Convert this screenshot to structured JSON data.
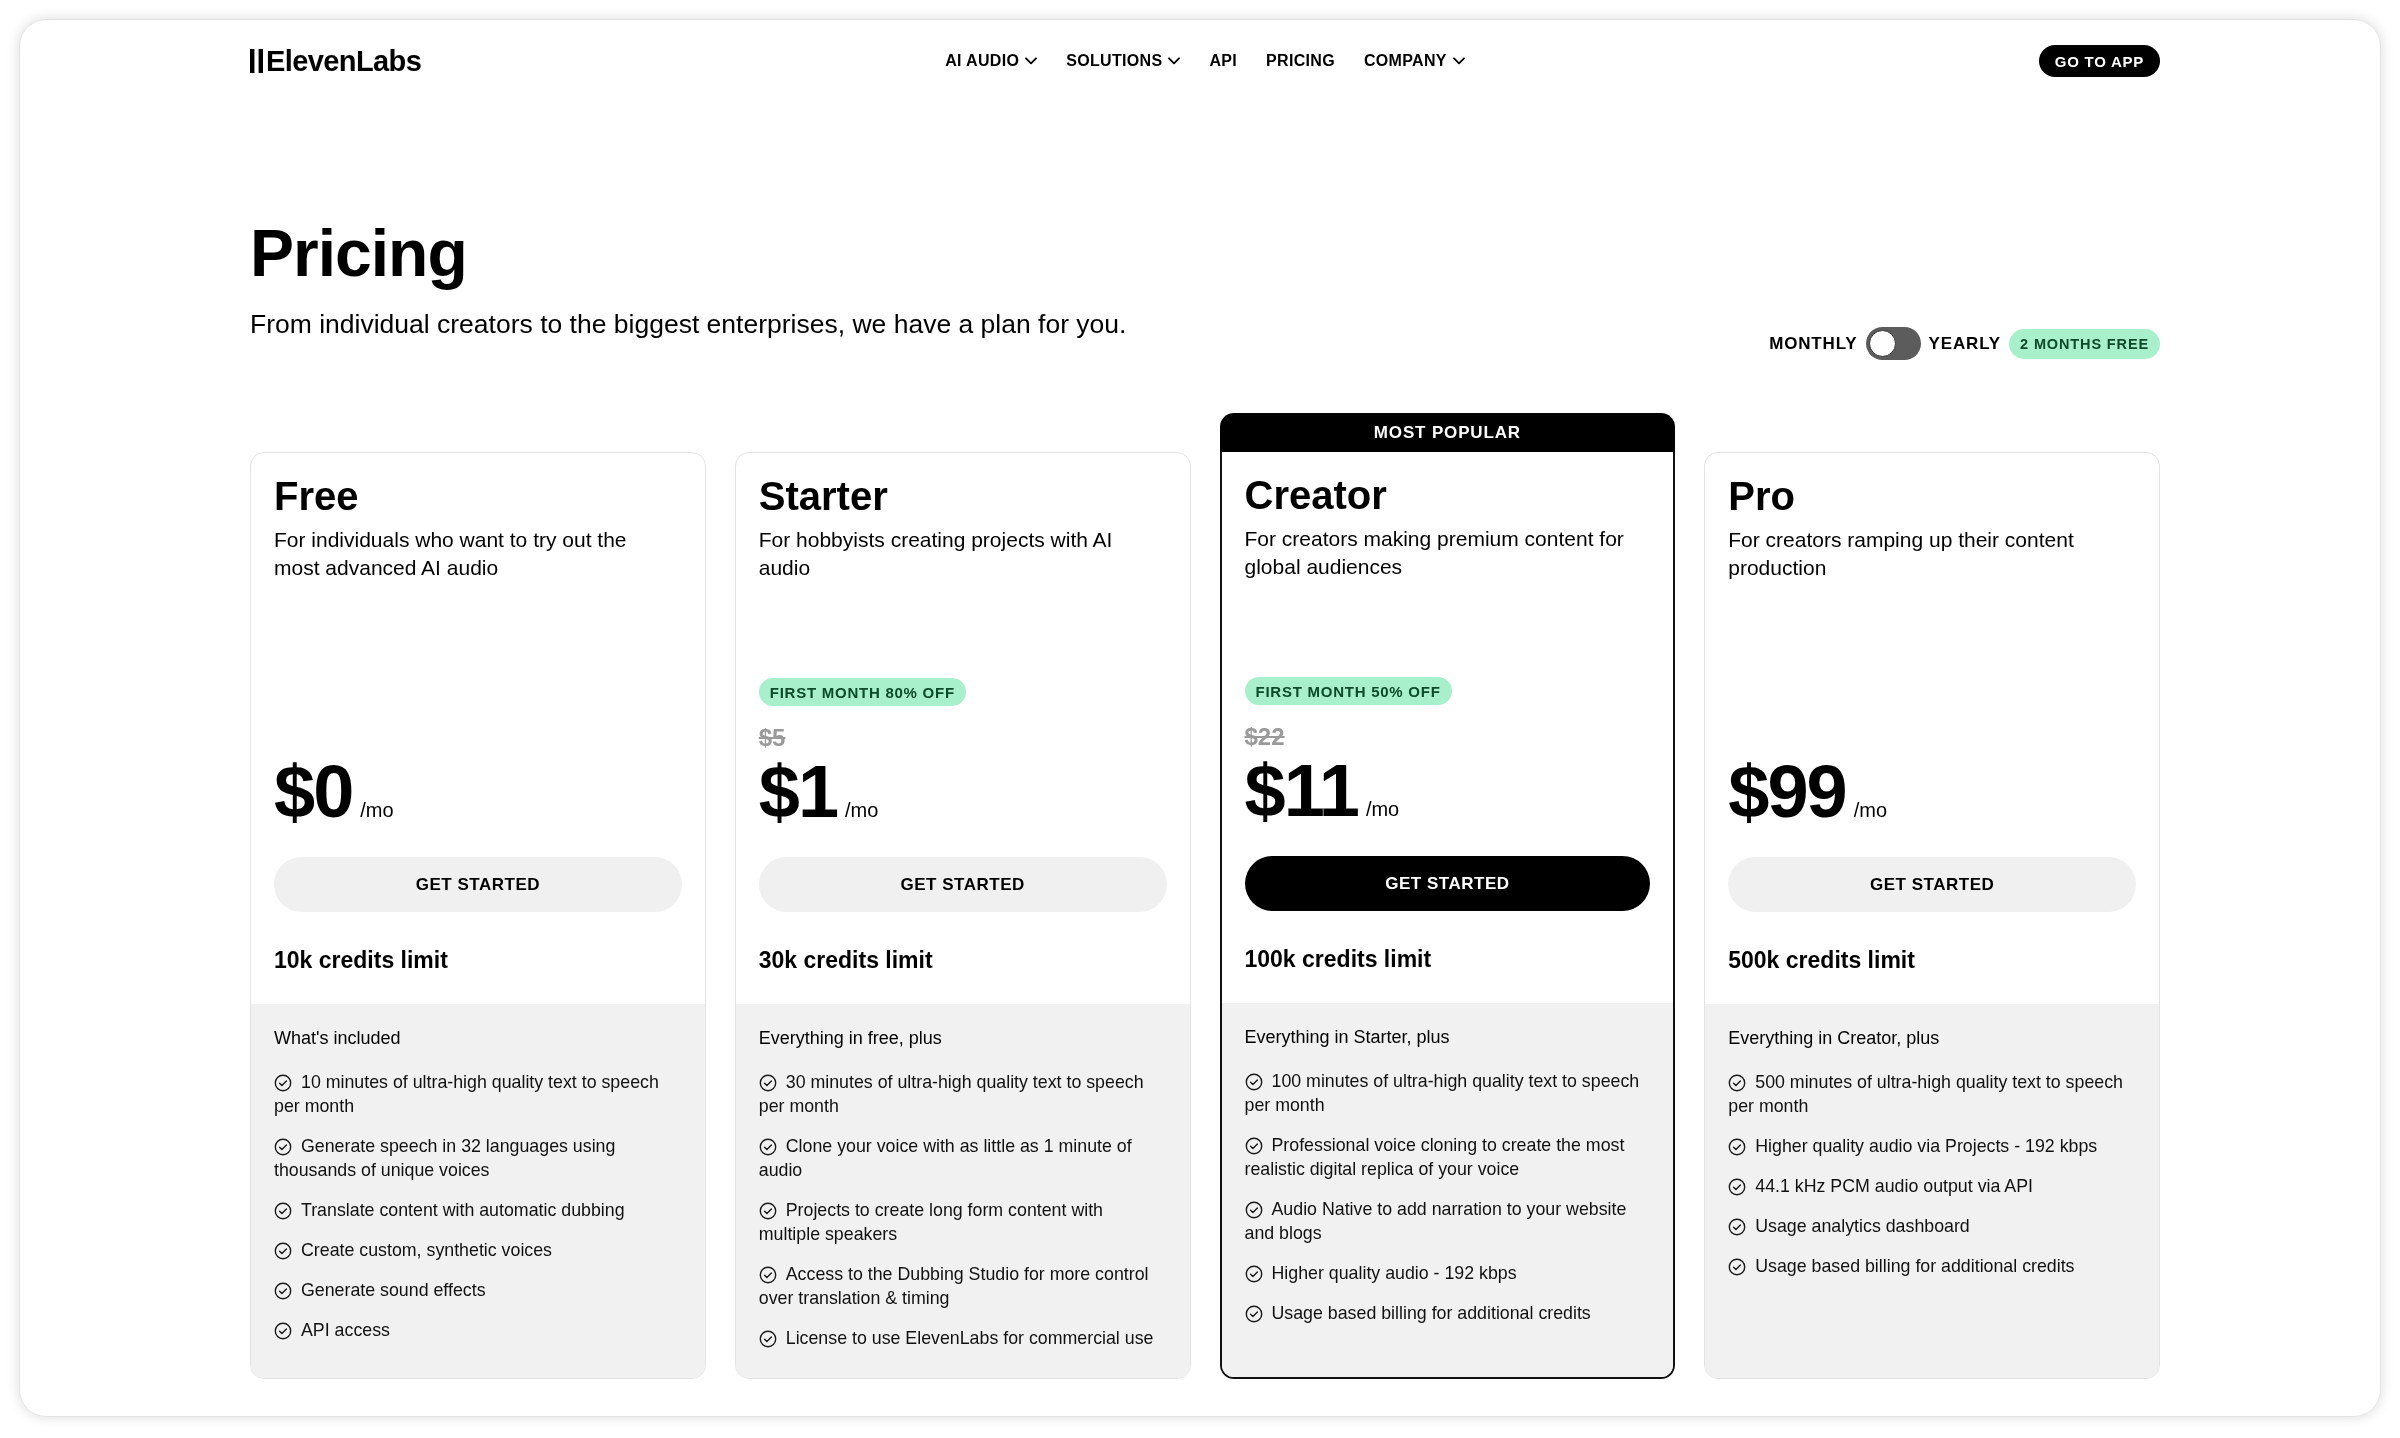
{
  "header": {
    "logo": "ElevenLabs",
    "nav": [
      {
        "label": "AI AUDIO",
        "dropdown": true
      },
      {
        "label": "SOLUTIONS",
        "dropdown": true
      },
      {
        "label": "API",
        "dropdown": false
      },
      {
        "label": "PRICING",
        "dropdown": false
      },
      {
        "label": "COMPANY",
        "dropdown": true
      }
    ],
    "cta": "GO TO APP"
  },
  "hero": {
    "title": "Pricing",
    "subtitle": "From individual creators to the biggest enterprises, we have a plan for you."
  },
  "billing": {
    "monthly_label": "MONTHLY",
    "on": false,
    "yearly_label": "YEARLY",
    "badge": "2 MONTHS FREE"
  },
  "plans": [
    {
      "name": "Free",
      "description": "For individuals who want to try out the most advanced AI audio",
      "highlighted": false,
      "price": "$0",
      "period": "/mo",
      "button": "GET STARTED",
      "credits": "10k credits limit",
      "features_heading": "What's included",
      "features": [
        "10 minutes of ultra-high quality text to speech per month",
        "Generate speech in 32 languages using thousands of unique voices",
        "Translate content with automatic dubbing",
        "Create custom, synthetic voices",
        "Generate sound effects",
        "API access"
      ]
    },
    {
      "name": "Starter",
      "description": "For hobbyists creating projects with AI audio",
      "highlighted": false,
      "promo": "FIRST MONTH 80% OFF",
      "old_price": "$5",
      "price": "$1",
      "period": "/mo",
      "button": "GET STARTED",
      "credits": "30k credits limit",
      "features_heading": "Everything in free, plus",
      "features": [
        "30 minutes of ultra-high quality text to speech per month",
        "Clone your voice with as little as 1 minute of audio",
        "Projects to create long form content with multiple speakers",
        "Access to the Dubbing Studio for more control over translation & timing",
        "License to use ElevenLabs for commercial use"
      ]
    },
    {
      "banner": "MOST POPULAR",
      "name": "Creator",
      "description": "For creators making premium content for global audiences",
      "highlighted": true,
      "promo": "FIRST MONTH 50% OFF",
      "old_price": "$22",
      "price": "$11",
      "period": "/mo",
      "button": "GET STARTED",
      "credits": "100k credits limit",
      "features_heading": "Everything in Starter, plus",
      "features": [
        "100 minutes of ultra-high quality text to speech per month",
        "Professional voice cloning to create the most realistic digital replica of your voice",
        "Audio Native to add narration to your website and blogs",
        "Higher quality audio - 192 kbps",
        "Usage based billing for additional credits"
      ]
    },
    {
      "name": "Pro",
      "description": "For creators ramping up their content production",
      "highlighted": false,
      "price": "$99",
      "period": "/mo",
      "button": "GET STARTED",
      "credits": "500k credits limit",
      "features_heading": "Everything in Creator, plus",
      "features": [
        "500 minutes of ultra-high quality text to speech per month",
        "Higher quality audio via Projects - 192 kbps",
        "44.1 kHz PCM audio output via API",
        "Usage analytics dashboard",
        "Usage based billing for additional credits"
      ]
    }
  ]
}
